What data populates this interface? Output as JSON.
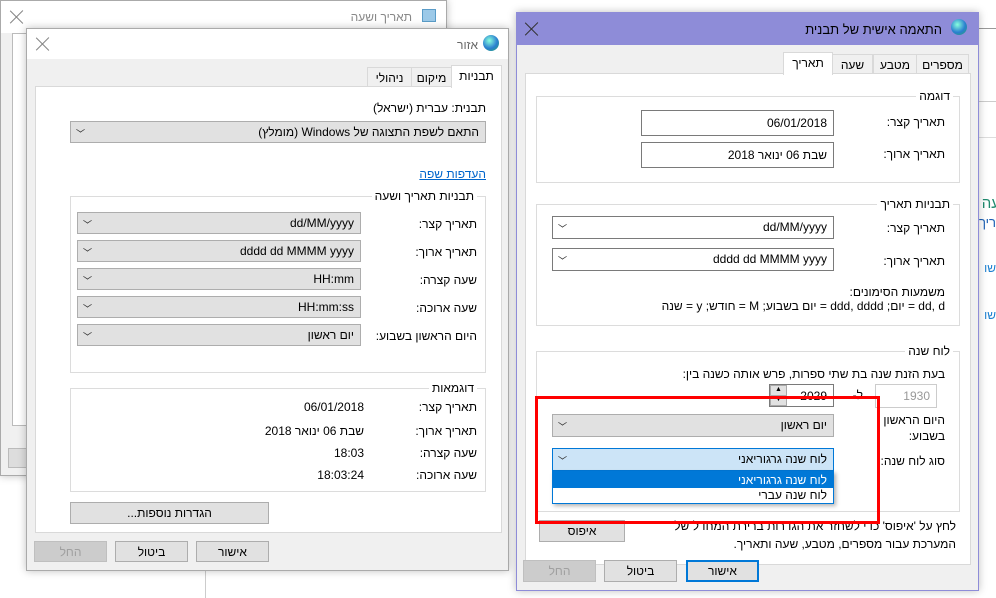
{
  "bg_window": {
    "title": "תאריך ושעה",
    "fragments": [
      "עה",
      "ריך",
      "שו",
      "שו"
    ]
  },
  "region": {
    "title": "אזור",
    "tabs": [
      {
        "label": "תבניות",
        "selected": true
      },
      {
        "label": "מיקום"
      },
      {
        "label": "ניהולי"
      }
    ],
    "format_label": "תבנית: עברית (ישראל)",
    "format_value": "התאם לשפת התצוגה של Windows (מומלץ)",
    "language_prefs_link": "העדפות שפה",
    "formats_group": {
      "title": "תבניות תאריך ושעה",
      "rows": [
        {
          "label": "תאריך קצר:",
          "value": "dd/MM/yyyy"
        },
        {
          "label": "תאריך ארוך:",
          "value": "dddd dd MMMM yyyy"
        },
        {
          "label": "שעה קצרה:",
          "value": "HH:mm"
        },
        {
          "label": "שעה ארוכה:",
          "value": "HH:mm:ss"
        },
        {
          "label": "היום הראשון בשבוע:",
          "value": "יום ראשון"
        }
      ]
    },
    "examples_group": {
      "title": "דוגמאות",
      "rows": [
        {
          "label": "תאריך קצר:",
          "value": "06/01/2018"
        },
        {
          "label": "תאריך ארוך:",
          "value": "שבת 06 ינואר 2018"
        },
        {
          "label": "שעה קצרה:",
          "value": "18:03"
        },
        {
          "label": "שעה ארוכה:",
          "value": "18:03:24"
        }
      ]
    },
    "additional_settings": "הגדרות נוספות...",
    "ok": "אישור",
    "cancel": "ביטול",
    "apply": "החל"
  },
  "customize": {
    "title": "התאמה אישית של תבנית",
    "title_bar_color": "#8e8cd8",
    "tabs": [
      {
        "label": "תאריך",
        "selected": true
      },
      {
        "label": "שעה"
      },
      {
        "label": "מטבע"
      },
      {
        "label": "מספרים"
      }
    ],
    "example_group": {
      "title": "דוגמה",
      "short_label": "תאריך קצר:",
      "short_value": "06/01/2018",
      "long_label": "תאריך ארוך:",
      "long_value": "שבת 06 ינואר 2018"
    },
    "formats_group": {
      "title": "תבניות תאריך",
      "short_label": "תאריך קצר:",
      "short_value": "dd/MM/yyyy",
      "long_label": "תאריך ארוך:",
      "long_value": "dddd dd MMMM yyyy",
      "legend_title": "משמעות הסימונים:",
      "legend": "dd, d = יום;  ddd, dddd = יום בשבוע;  M = חודש;  y = שנה"
    },
    "calendar_group": {
      "title": "לוח שנה",
      "two_digit_text": "בעת הזנת שנה בת שתי ספרות, פרש אותה כשנה בין:",
      "year_from": "1930",
      "to_label": "ל-",
      "year_to": "2029",
      "first_day_label_1": "היום הראשון",
      "first_day_label_2": "בשבוע:",
      "first_day_value": "יום ראשון",
      "calendar_type_label": "סוג לוח שנה:",
      "calendar_type_value": "לוח שנה גרגוריאני",
      "calendar_options": [
        {
          "label": "לוח שנה גרגוריאני",
          "highlighted": true
        },
        {
          "label": "לוח שנה עברי"
        }
      ]
    },
    "reset_text_1": "לחץ על 'איפוס' כדי לשחזר את הגדרות ברירת המחדל של",
    "reset_text_2": "המערכת עבור מספרים, מטבע, שעה ותאריך.",
    "reset": "איפוס",
    "ok": "אישור",
    "cancel": "ביטול",
    "apply": "החל"
  },
  "highlight_color": "#ff0000"
}
